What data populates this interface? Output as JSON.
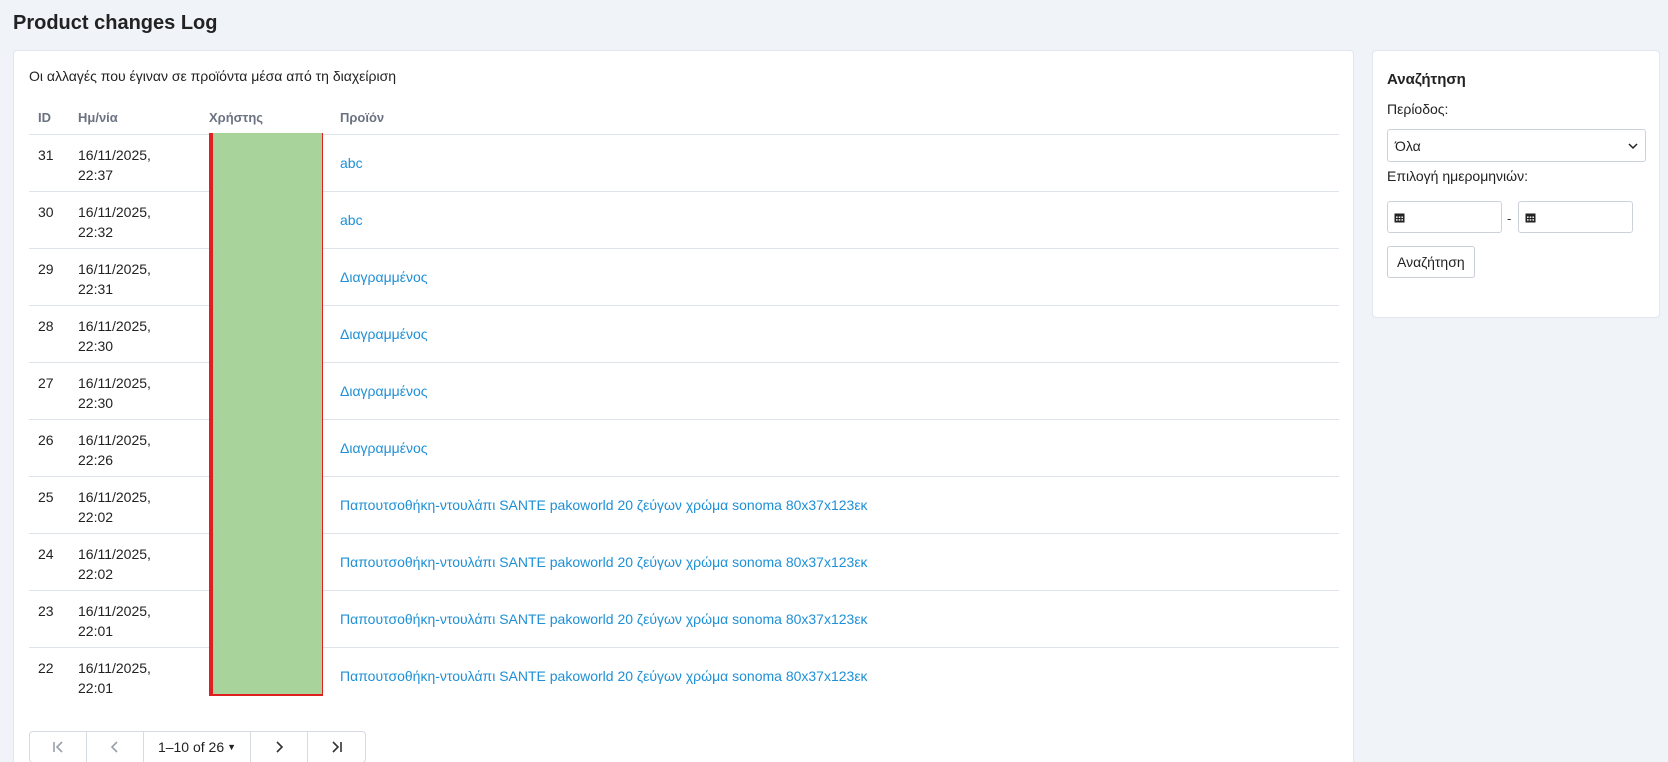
{
  "page_title": "Product changes Log",
  "main": {
    "subtitle": "Οι αλλαγές που έγιναν σε προϊόντα μέσα από τη διαχείριση",
    "columns": [
      "ID",
      "Ημ/νία",
      "Χρήστης",
      "Προϊόν"
    ],
    "rows": [
      {
        "id": "31",
        "date": "16/11/2025,",
        "time": "22:37",
        "product": "abc"
      },
      {
        "id": "30",
        "date": "16/11/2025,",
        "time": "22:32",
        "product": "abc"
      },
      {
        "id": "29",
        "date": "16/11/2025,",
        "time": "22:31",
        "product": "Διαγραμμένος"
      },
      {
        "id": "28",
        "date": "16/11/2025,",
        "time": "22:30",
        "product": "Διαγραμμένος"
      },
      {
        "id": "27",
        "date": "16/11/2025,",
        "time": "22:30",
        "product": "Διαγραμμένος"
      },
      {
        "id": "26",
        "date": "16/11/2025,",
        "time": "22:26",
        "product": "Διαγραμμένος"
      },
      {
        "id": "25",
        "date": "16/11/2025,",
        "time": "22:02",
        "product": "Παπουτσοθήκη-ντουλάπι SANTE pakoworld 20 ζεύγων χρώμα sonoma 80x37x123εκ"
      },
      {
        "id": "24",
        "date": "16/11/2025,",
        "time": "22:02",
        "product": "Παπουτσοθήκη-ντουλάπι SANTE pakoworld 20 ζεύγων χρώμα sonoma 80x37x123εκ"
      },
      {
        "id": "23",
        "date": "16/11/2025,",
        "time": "22:01",
        "product": "Παπουτσοθήκη-ντουλάπι SANTE pakoworld 20 ζεύγων χρώμα sonoma 80x37x123εκ"
      },
      {
        "id": "22",
        "date": "16/11/2025,",
        "time": "22:01",
        "product": "Παπουτσοθήκη-ντουλάπι SANTE pakoworld 20 ζεύγων χρώμα sonoma 80x37x123εκ"
      }
    ],
    "pagination": {
      "range": "1–10 of 26",
      "first_icon": "first-page-icon",
      "prev_icon": "chevron-left-icon",
      "next_icon": "chevron-right-icon",
      "last_icon": "last-page-icon"
    }
  },
  "sidebar": {
    "title": "Αναζήτηση",
    "period_label": "Περίοδος:",
    "period_value": "Όλα",
    "date_range_label": "Επιλογή ημερομηνιών:",
    "date_separator": "-",
    "search_button": "Αναζήτηση",
    "calendar_icon": "calendar-icon"
  },
  "colors": {
    "link": "#1e90d6",
    "background": "#f0f3f8",
    "redaction_fill": "#a8d39a",
    "redaction_border": "#e02020"
  }
}
